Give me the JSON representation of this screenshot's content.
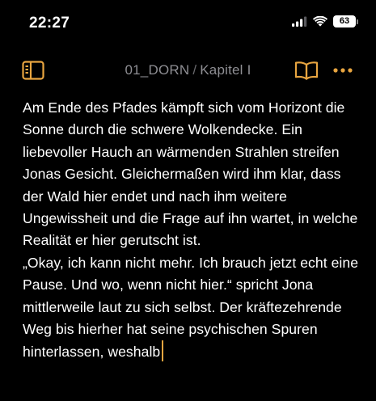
{
  "status_bar": {
    "time": "22:27",
    "battery": "63"
  },
  "toolbar": {
    "title_file": "01_DORN",
    "title_separator": "/",
    "title_chapter": "Kapitel I",
    "accent_color": "#E8A540"
  },
  "content": {
    "paragraphs": [
      "Am Ende des Pfades kämpft sich vom Horizont die Sonne durch die schwere Wolkendecke. Ein liebevoller Hauch an wärmenden Strahlen streifen Jonas Gesicht. Gleichermaßen wird ihm klar, dass der Wald hier endet und nach ihm weitere Ungewissheit und die Frage auf ihn wartet, in welche Realität er hier gerutscht ist.",
      "„Okay, ich kann nicht mehr. Ich brauch jetzt echt eine Pause. Und wo, wenn nicht hier.“ spricht Jona mittlerweile laut zu sich selbst. Der kräftezehrende Weg bis hierher hat seine psychischen Spuren hinterlassen, weshalb"
    ]
  },
  "icons": {
    "toc": "sidebar-toc-icon",
    "book": "open-book-icon",
    "more": "ellipsis-icon",
    "signal": "cellular-signal-icon",
    "wifi": "wifi-icon",
    "battery": "battery-icon"
  }
}
